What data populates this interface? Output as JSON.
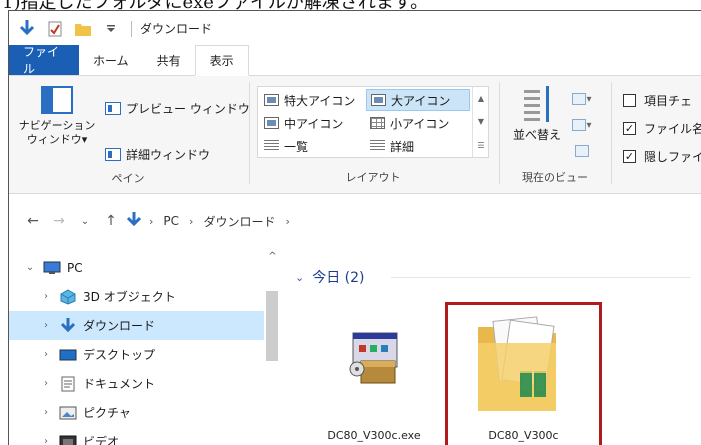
{
  "caption": "1)指定したフォルダにexeファイルが解凍されます。",
  "window": {
    "title": "ダウンロード"
  },
  "tabs": [
    {
      "label": "ファイル"
    },
    {
      "label": "ホーム"
    },
    {
      "label": "共有"
    },
    {
      "label": "表示"
    }
  ],
  "ribbon": {
    "pane": {
      "nav_pane": "ナビゲーション\nウィンドウ▾",
      "preview": "プレビュー ウィンドウ",
      "details": "詳細ウィンドウ",
      "label": "ペイン"
    },
    "layout": {
      "items": [
        "特大アイコン",
        "大アイコン",
        "中アイコン",
        "小アイコン",
        "一覧",
        "詳細"
      ],
      "selected": "大アイコン",
      "label": "レイアウト"
    },
    "view": {
      "sort": "並べ替え",
      "label": "現在のビュー"
    },
    "show_hide": {
      "item_check": "項目チェ",
      "extensions": "ファイル名",
      "hidden": "隠しファイ"
    }
  },
  "address": {
    "pc": "PC",
    "folder": "ダウンロード"
  },
  "nav": {
    "items": [
      {
        "label": "PC",
        "icon": "pc-icon"
      },
      {
        "label": "3D オブジェクト",
        "icon": "3d-objects-icon"
      },
      {
        "label": "ダウンロード",
        "icon": "download-icon"
      },
      {
        "label": "デスクトップ",
        "icon": "desktop-icon"
      },
      {
        "label": "ドキュメント",
        "icon": "documents-icon"
      },
      {
        "label": "ピクチャ",
        "icon": "pictures-icon"
      },
      {
        "label": "ビデオ",
        "icon": "videos-icon"
      }
    ],
    "selected": "ダウンロード"
  },
  "content": {
    "group": "今日 (2)",
    "files": [
      {
        "name": "DC80_V300c.exe",
        "icon": "installer-exe-icon"
      },
      {
        "name": "DC80_V300c",
        "icon": "folder-icon",
        "highlighted": true
      }
    ]
  },
  "colors": {
    "file_tab": "#1a5fb4",
    "accent_blue": "#2a6fc2",
    "selection": "#cce8ff",
    "highlight_border": "#b01c1c",
    "group_header": "#1e3d8f"
  }
}
